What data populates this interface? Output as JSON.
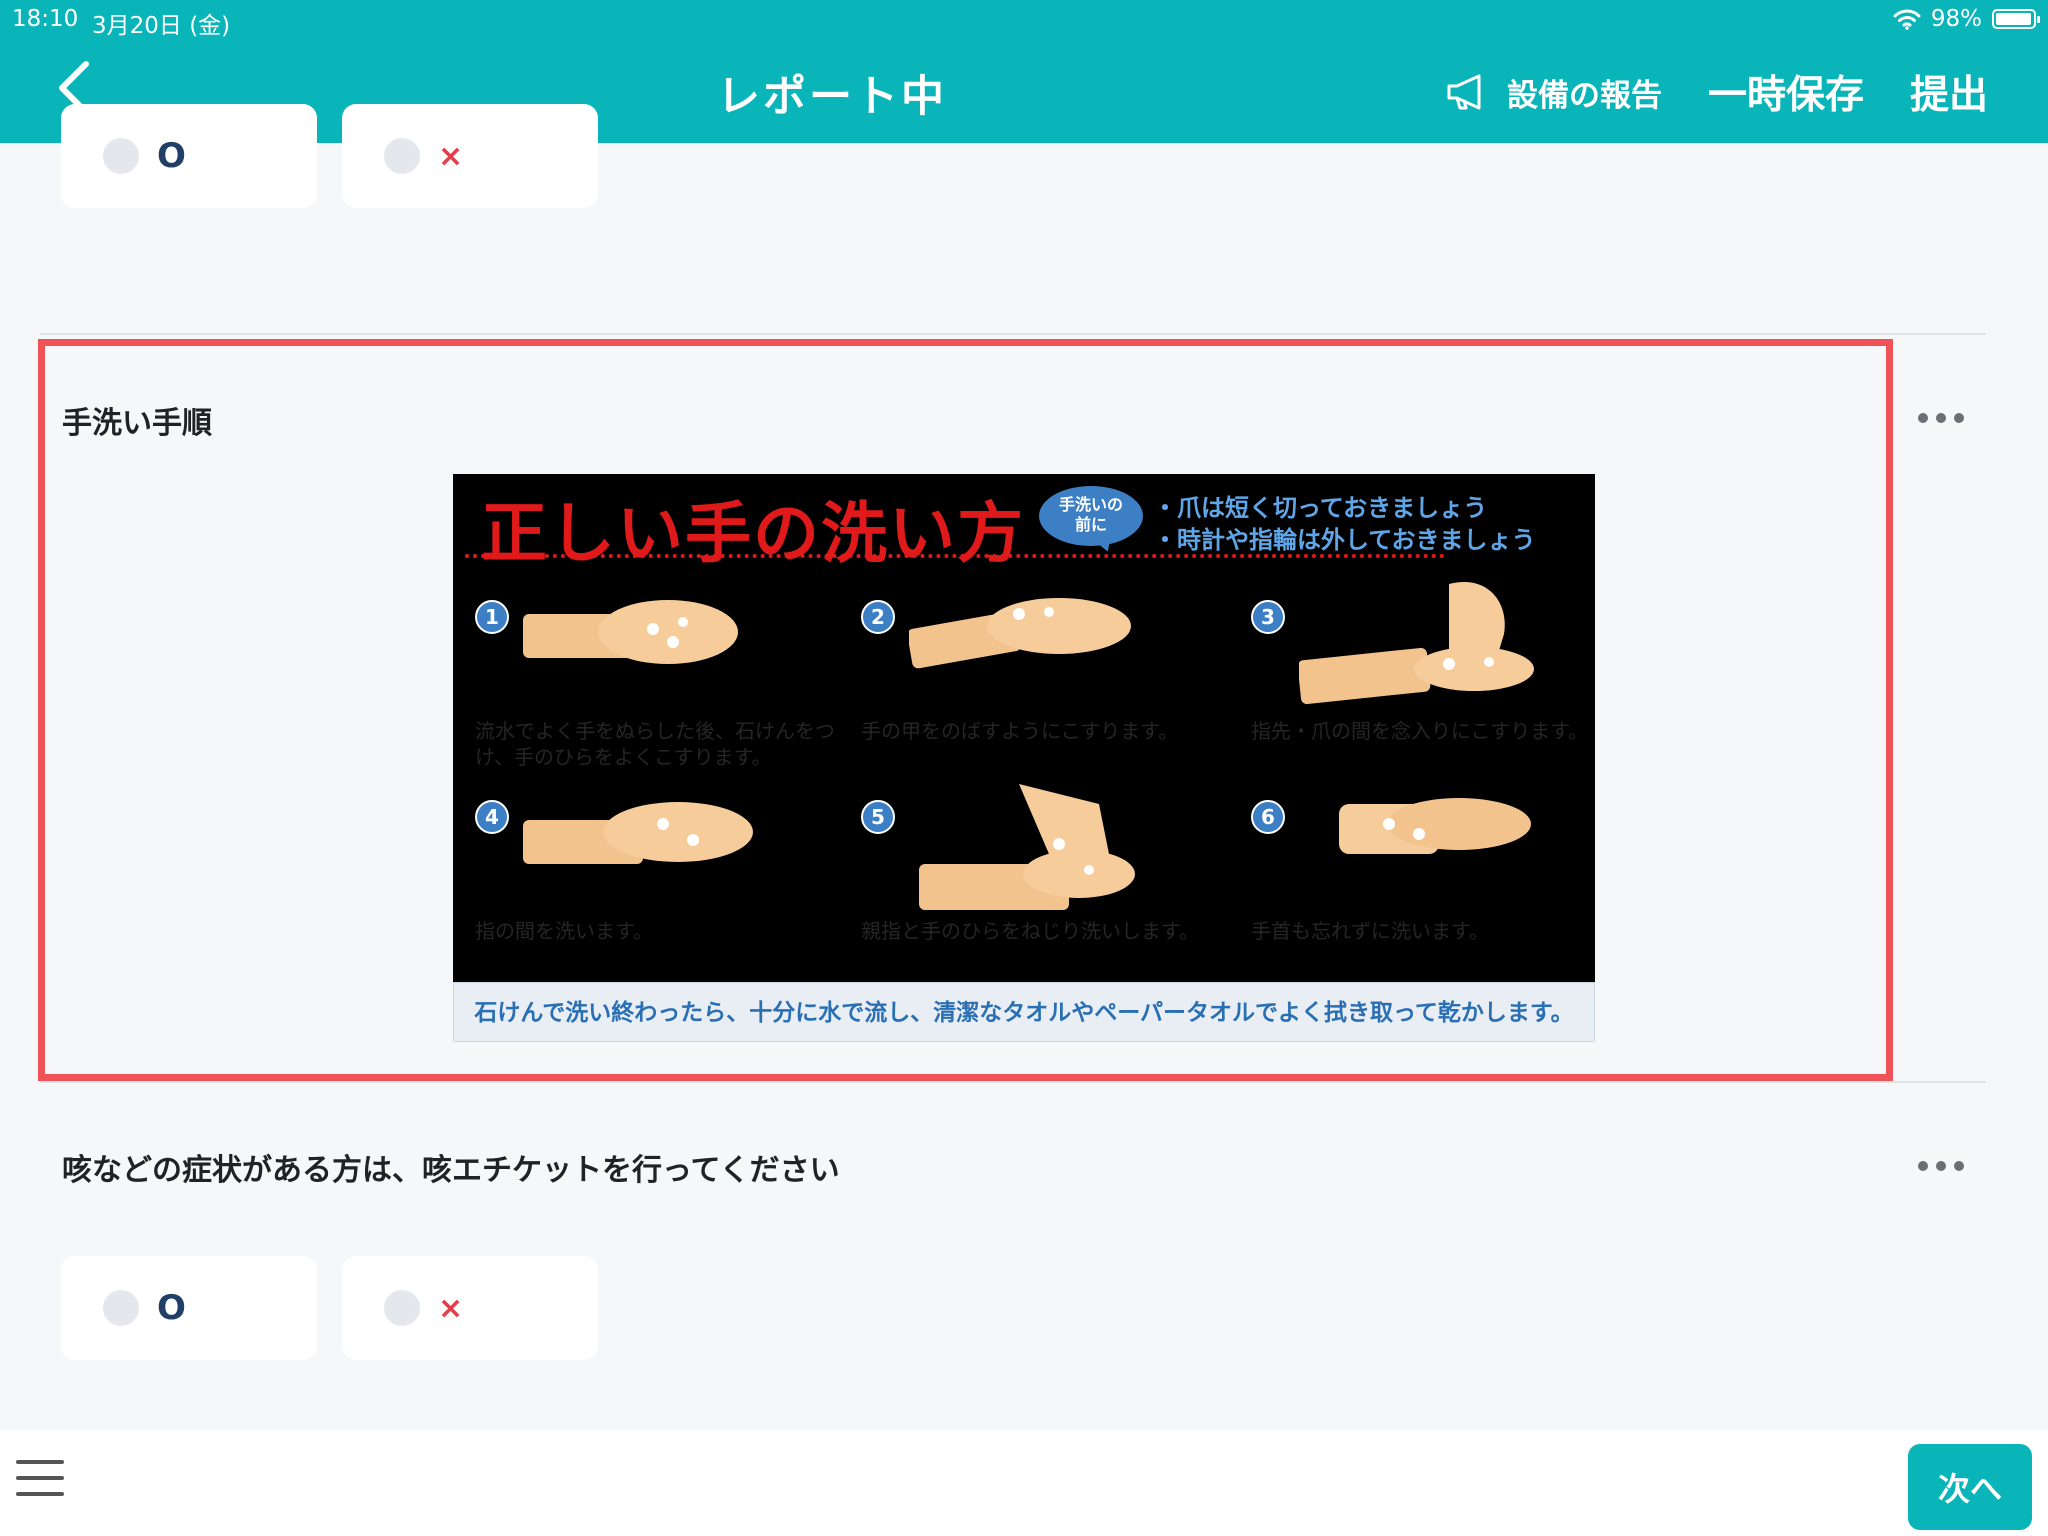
{
  "status_bar": {
    "time": "18:10",
    "date": "3月20日 (金)",
    "battery": "98%"
  },
  "nav": {
    "title": "レポート中",
    "report_label": "設備の報告",
    "save_label": "一時保存",
    "submit_label": "提出"
  },
  "questions": [
    {
      "label": "手洗い手順",
      "poster": {
        "title": "正しい手の洗い方",
        "bubble": "手洗いの\n前に",
        "tips": [
          "・爪は短く切っておきましょう",
          "・時計や指輪は外しておきましょう"
        ],
        "steps": [
          {
            "num": "1",
            "caption": "流水でよく手をぬらした後、石けんをつけ、手のひらをよくこすります。"
          },
          {
            "num": "2",
            "caption": "手の甲をのばすようにこすります。"
          },
          {
            "num": "3",
            "caption": "指先・爪の間を念入りにこすります。"
          },
          {
            "num": "4",
            "caption": "指の間を洗います。"
          },
          {
            "num": "5",
            "caption": "親指と手のひらをねじり洗いします。"
          },
          {
            "num": "6",
            "caption": "手首も忘れずに洗います。"
          }
        ],
        "footer": "石けんで洗い終わったら、十分に水で流し、清潔なタオルやペーパータオルでよく拭き取って乾かします。"
      }
    },
    {
      "label": "咳などの症状がある方は、咳エチケットを行ってください"
    }
  ],
  "options": {
    "yes": "O",
    "no": "×"
  },
  "bottom": {
    "next_label": "次へ"
  },
  "colors": {
    "accent": "#09b5b9",
    "highlight": "#ef5358",
    "no_mark": "#e1404a"
  }
}
